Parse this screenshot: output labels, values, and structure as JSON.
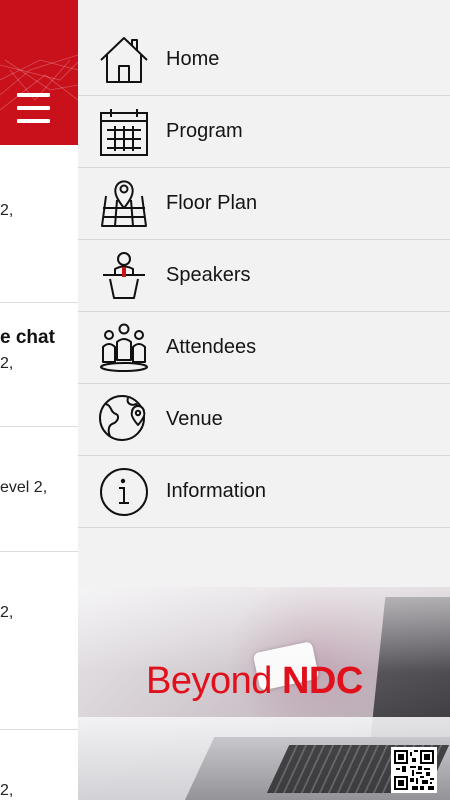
{
  "background_screen": {
    "items": [
      {
        "text": "2,"
      },
      {
        "text": "e chat",
        "sub": "2,"
      },
      {
        "text": "evel 2,"
      },
      {
        "text": "2,"
      },
      {
        "text": "2,"
      }
    ]
  },
  "menu": {
    "items": [
      {
        "label": "Home",
        "icon": "home-icon"
      },
      {
        "label": "Program",
        "icon": "calendar-icon"
      },
      {
        "label": "Floor Plan",
        "icon": "floor-plan-icon"
      },
      {
        "label": "Speakers",
        "icon": "speaker-podium-icon"
      },
      {
        "label": "Attendees",
        "icon": "attendees-icon"
      },
      {
        "label": "Venue",
        "icon": "globe-location-icon"
      },
      {
        "label": "Information",
        "icon": "info-icon"
      }
    ]
  },
  "banner": {
    "title_light": "Beyond",
    "title_bold": "NDC"
  },
  "colors": {
    "brand_red": "#c9111c",
    "drawer_bg": "#f2f2f2"
  }
}
